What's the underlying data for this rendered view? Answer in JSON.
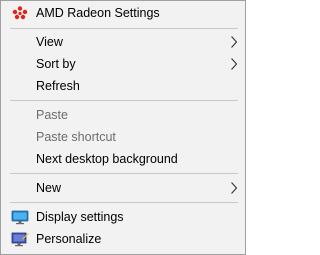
{
  "menu": {
    "items": [
      {
        "label": "AMD Radeon Settings",
        "icon": "amd-radeon-icon",
        "enabled": true
      },
      {
        "label": "View",
        "submenu": true,
        "enabled": true
      },
      {
        "label": "Sort by",
        "submenu": true,
        "enabled": true
      },
      {
        "label": "Refresh",
        "enabled": true
      },
      {
        "label": "Paste",
        "enabled": false
      },
      {
        "label": "Paste shortcut",
        "enabled": false
      },
      {
        "label": "Next desktop background",
        "enabled": true
      },
      {
        "label": "New",
        "submenu": true,
        "enabled": true
      },
      {
        "label": "Display settings",
        "icon": "monitor-icon",
        "enabled": true
      },
      {
        "label": "Personalize",
        "icon": "personalize-icon",
        "enabled": true
      }
    ],
    "colors": {
      "background": "#f2f2f2",
      "border": "#a0a0a0",
      "separator": "#c8c8c8",
      "text": "#000000",
      "disabled_text": "#6d6d6d",
      "amd_red": "#e2231a"
    }
  }
}
